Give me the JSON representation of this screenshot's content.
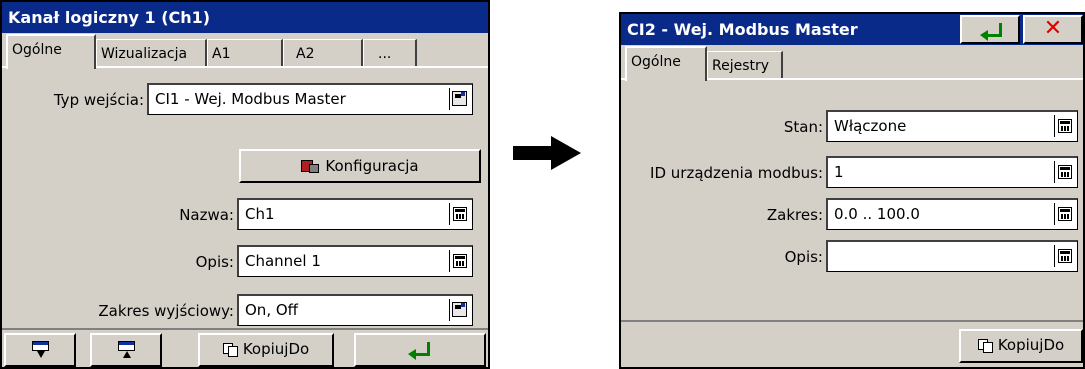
{
  "left_dialog": {
    "title": "Kanał logiczny 1 (Ch1)",
    "tabs": [
      "Ogólne",
      "Wizualizacja",
      "A1",
      "A2",
      "..."
    ],
    "fields": {
      "input_type_label": "Typ wejścia:",
      "input_type_value": "CI1 - Wej. Modbus Master",
      "config_button": "Konfiguracja",
      "name_label": "Nazwa:",
      "name_value": "Ch1",
      "desc_label": "Opis:",
      "desc_value": "Channel 1",
      "range_label": "Zakres wyjściowy:",
      "range_value": "On, Off"
    },
    "bottom": {
      "copy_label": "KopiujDo"
    }
  },
  "right_dialog": {
    "title": "CI2 - Wej. Modbus Master",
    "tabs": [
      "Ogólne",
      "Rejestry"
    ],
    "fields": {
      "state_label": "Stan:",
      "state_value": "Włączone",
      "device_id_label": "ID urządzenia modbus:",
      "device_id_value": "1",
      "range_label": "Zakres:",
      "range_value": "0.0 .. 100.0",
      "desc_label": "Opis:",
      "desc_value": ""
    },
    "bottom": {
      "copy_label": "KopiujDo"
    },
    "close_glyph": "✕"
  },
  "colors": {
    "titlebar": "#0a2a8a",
    "window_bg": "#d4d0c8",
    "enter_green": "#008000",
    "close_red": "#e00000"
  }
}
